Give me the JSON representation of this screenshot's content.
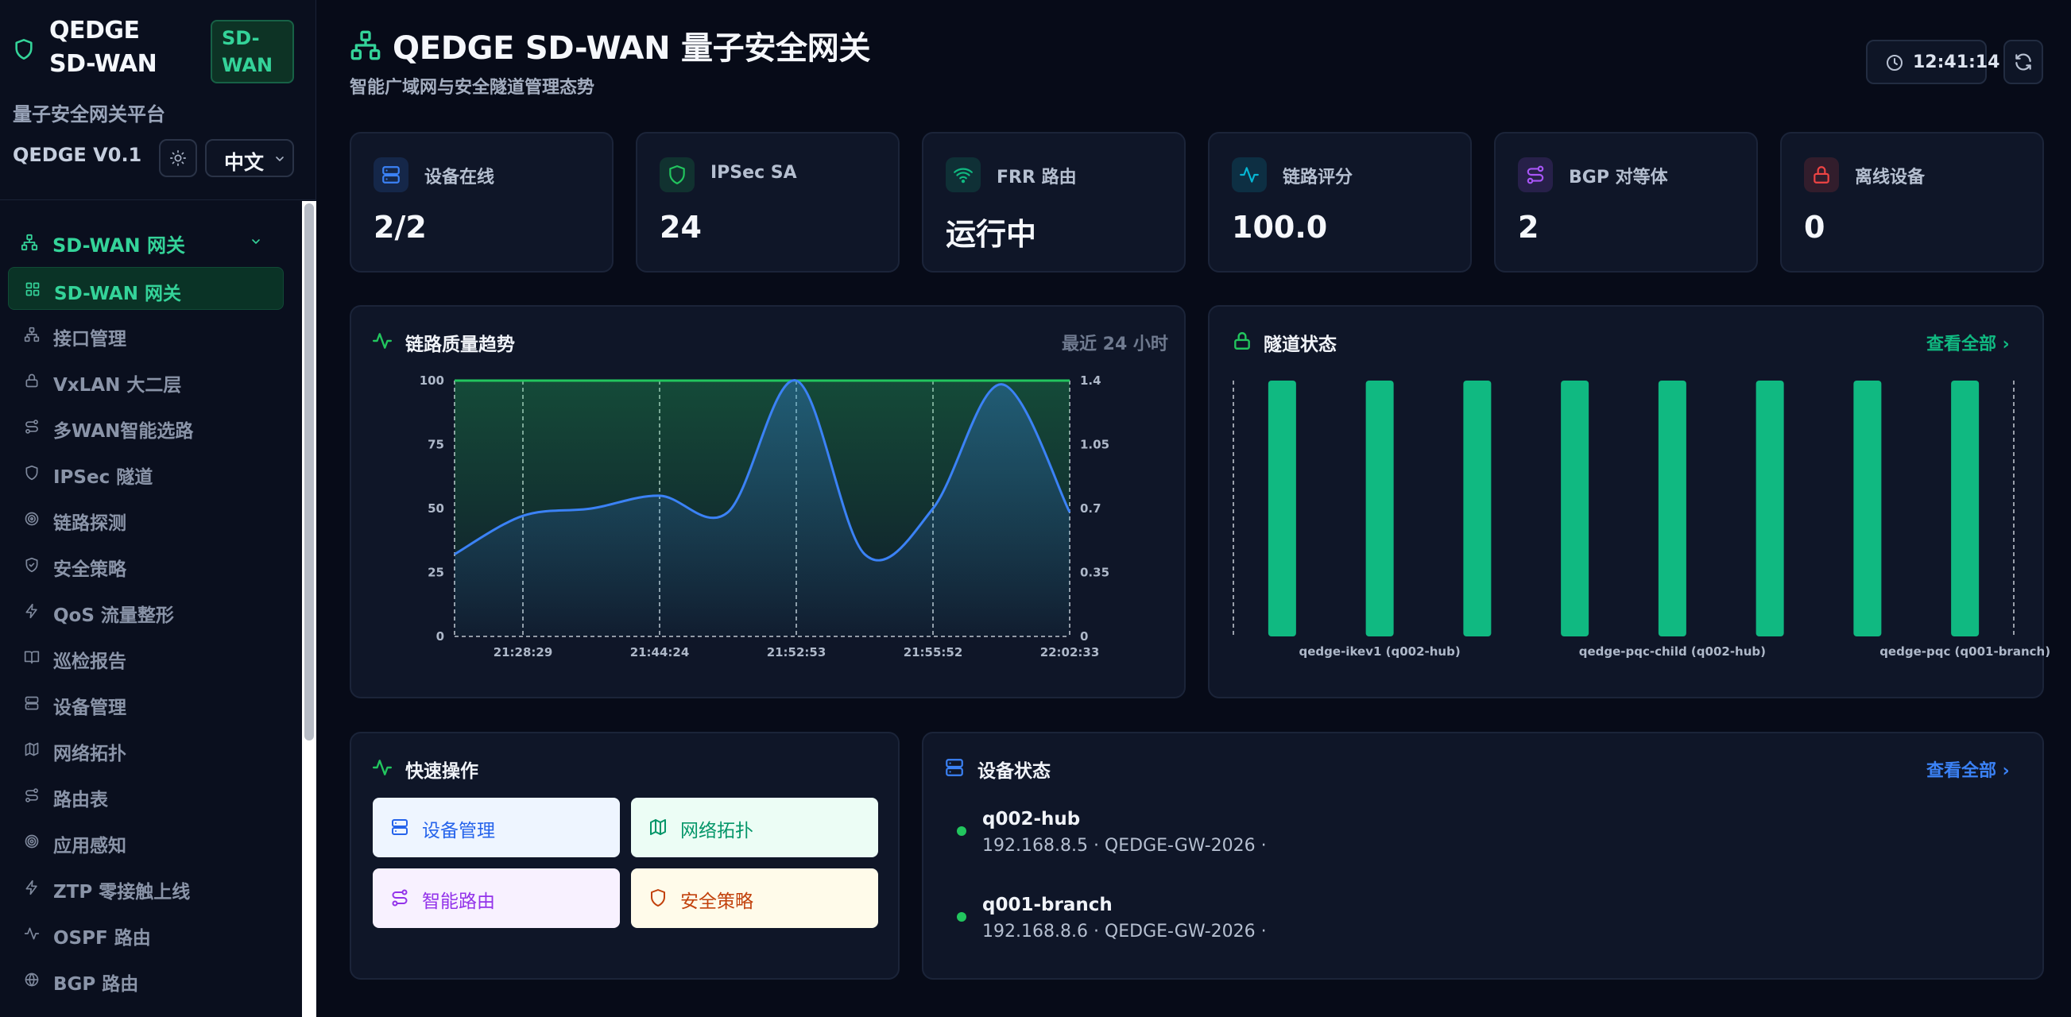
{
  "sidebar": {
    "brand_name": "QEDGE SD-WAN",
    "brand_badge": "SD-WAN",
    "brand_subtitle": "量子安全网关平台",
    "version": "QEDGE V0.1",
    "language": "中文",
    "group_label": "SD-WAN 网关",
    "items": [
      {
        "label": "SD-WAN 网关",
        "icon": "grid-icon",
        "active": true
      },
      {
        "label": "接口管理",
        "icon": "network-icon"
      },
      {
        "label": "VxLAN 大二层",
        "icon": "lock-icon"
      },
      {
        "label": "多WAN智能选路",
        "icon": "route-icon"
      },
      {
        "label": "IPSec 隧道",
        "icon": "shield-icon"
      },
      {
        "label": "链路探测",
        "icon": "radar-icon"
      },
      {
        "label": "安全策略",
        "icon": "shield-check-icon"
      },
      {
        "label": "QoS 流量整形",
        "icon": "zap-icon"
      },
      {
        "label": "巡检报告",
        "icon": "book-icon"
      },
      {
        "label": "设备管理",
        "icon": "server-icon"
      },
      {
        "label": "网络拓扑",
        "icon": "map-icon"
      },
      {
        "label": "路由表",
        "icon": "route-icon"
      },
      {
        "label": "应用感知",
        "icon": "target-icon"
      },
      {
        "label": "ZTP 零接触上线",
        "icon": "zap-icon"
      },
      {
        "label": "OSPF 路由",
        "icon": "activity-icon"
      },
      {
        "label": "BGP 路由",
        "icon": "globe-icon"
      }
    ]
  },
  "header": {
    "title": "QEDGE SD-WAN 量子安全网关",
    "subtitle": "智能广域网与安全隧道管理态势",
    "clock": "12:41:14"
  },
  "stats": [
    {
      "label": "设备在线",
      "value": "2/2",
      "icon": "server-icon",
      "color": "#3b82f6"
    },
    {
      "label": "IPSec SA",
      "value": "24",
      "icon": "shield-icon",
      "color": "#22c55e"
    },
    {
      "label": "FRR 路由",
      "value": "运行中",
      "icon": "wifi-icon",
      "color": "#10b981"
    },
    {
      "label": "链路评分",
      "value": "100.0",
      "icon": "activity-icon",
      "color": "#06b6d4"
    },
    {
      "label": "BGP 对等体",
      "value": "2",
      "icon": "route-icon",
      "color": "#a855f7"
    },
    {
      "label": "离线设备",
      "value": "0",
      "icon": "lock-icon",
      "color": "#ef4444"
    }
  ],
  "link_panel": {
    "title": "链路质量趋势",
    "range": "最近 24 小时"
  },
  "tunnel_panel": {
    "title": "隧道状态",
    "link": "查看全部 ›"
  },
  "quick_panel": {
    "title": "快速操作",
    "actions": [
      {
        "label": "设备管理",
        "icon": "server-icon",
        "bg": "#eef5ff",
        "color": "#2563eb"
      },
      {
        "label": "网络拓扑",
        "icon": "map-icon",
        "bg": "#ecfdf5",
        "color": "#059669"
      },
      {
        "label": "智能路由",
        "icon": "route-icon",
        "bg": "#f8f1ff",
        "color": "#9333ea"
      },
      {
        "label": "安全策略",
        "icon": "shield-icon",
        "bg": "#fffbea",
        "color": "#c2410c"
      }
    ]
  },
  "device_panel": {
    "title": "设备状态",
    "link": "查看全部 ›",
    "devices": [
      {
        "name": "q002-hub",
        "meta": "192.168.8.5 · QEDGE-GW-2026 ·",
        "status_color": "#22c55e"
      },
      {
        "name": "q001-branch",
        "meta": "192.168.8.6 · QEDGE-GW-2026 ·",
        "status_color": "#22c55e"
      }
    ]
  },
  "chart_data": [
    {
      "type": "line",
      "title": "链路质量趋势",
      "x_ticks": [
        "21:28:29",
        "21:44:24",
        "21:52:53",
        "21:55:52",
        "22:02:33"
      ],
      "y_left": {
        "ticks": [
          0,
          25,
          50,
          75,
          100
        ],
        "range": [
          0,
          100
        ]
      },
      "y_right": {
        "ticks": [
          0,
          0.35,
          0.7,
          1.05,
          1.4
        ],
        "range": [
          0,
          1.4
        ]
      },
      "series": [
        {
          "axis": "left",
          "color": "#22c55e",
          "values": [
            100,
            100,
            100,
            100,
            100,
            100,
            100,
            100,
            100,
            100
          ]
        },
        {
          "axis": "right",
          "color": "#3b82f6",
          "values": [
            0.45,
            0.66,
            0.7,
            0.77,
            0.68,
            1.4,
            0.45,
            0.7,
            1.38,
            0.68
          ]
        }
      ]
    },
    {
      "type": "bar",
      "title": "隧道状态",
      "categories": [
        "qedge-ikev1 (q002-hub)",
        "qedge-pqc-child (q002-hub)",
        "qedge-pqc (q001-branch)"
      ],
      "bar_count": 8,
      "values": [
        1,
        1,
        1,
        1,
        1,
        1,
        1,
        1
      ],
      "color": "#10b981"
    }
  ]
}
